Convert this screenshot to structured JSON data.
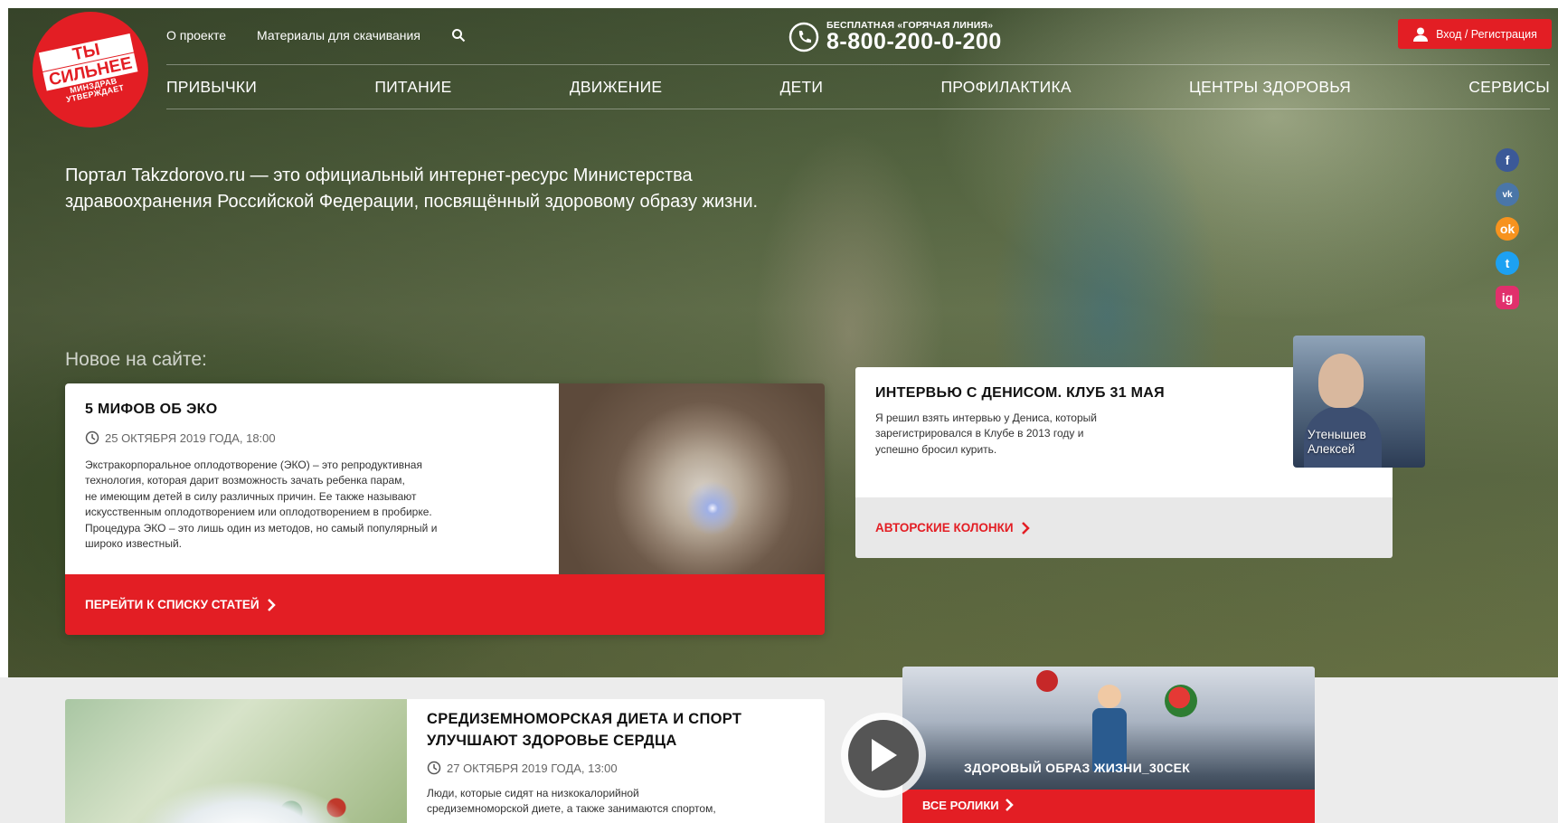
{
  "header": {
    "logo": {
      "hash": "#",
      "line1": "ТЫ",
      "line2": "СИЛЬНЕЕ",
      "line3": "МИНЗДРАВ",
      "line4": "УТВЕРЖДАЕТ"
    },
    "top_links": [
      "О проекте",
      "Материалы для скачивания"
    ],
    "hotline_caption": "БЕСПЛАТНАЯ «ГОРЯЧАЯ ЛИНИЯ»",
    "hotline_number": "8-800-200-0-200",
    "login_label": "Вход / Регистрация",
    "nav": [
      "ПРИВЫЧКИ",
      "ПИТАНИЕ",
      "ДВИЖЕНИЕ",
      "ДЕТИ",
      "ПРОФИЛАКТИКА",
      "ЦЕНТРЫ ЗДОРОВЬЯ",
      "СЕРВИСЫ"
    ]
  },
  "intro_text": "Портал Takzdorovo.ru — это официальный интернет-ресурс Министерства здравоохранения Российской Федерации, посвящённый здоровому образу жизни.",
  "social": {
    "facebook": "f",
    "vk": "vk",
    "ok": "ok",
    "twitter": "t",
    "instagram": "ig"
  },
  "new_label": "Новое на сайте:",
  "article_main": {
    "title": "5 МИФОВ ОБ ЭКО",
    "date": "25 ОКТЯБРЯ 2019 ГОДА, 18:00",
    "desc_lines": [
      "Экстракорпоральное оплодотворение (ЭКО) – это репродуктивная",
      "технология, которая дарит возможность зачать ребенка парам,",
      "не имеющим детей в силу различных причин. Ее также называют",
      "искусственным оплодотворением или оплодотворением в пробирке.",
      "Процедура ЭКО – это лишь один из методов, но самый популярный и",
      "широко известный."
    ],
    "link": "ПЕРЕЙТИ К СПИСКУ СТАТЕЙ"
  },
  "interview": {
    "title": "ИНТЕРВЬЮ С ДЕНИСОМ. КЛУБ 31 МАЯ",
    "desc_lines": [
      "Я решил взять интервью у Дениса, который",
      "зарегистрировался в Клубе в 2013 году и",
      "успешно бросил курить."
    ],
    "author": [
      "Утенышев",
      "Алексей"
    ],
    "link": "АВТОРСКИЕ КОЛОНКИ"
  },
  "article_second": {
    "title": "СРЕДИЗЕМНОМОРСКАЯ ДИЕТА И СПОРТ УЛУЧШАЮТ ЗДОРОВЬЕ СЕРДЦА",
    "date": "27 ОКТЯБРЯ 2019 ГОДА, 13:00",
    "desc_lines": [
      "Люди, которые сидят на низкокалорийной",
      "средиземноморской диете, а также занимаются спортом,"
    ]
  },
  "video": {
    "title": "ЗДОРОВЫЙ ОБРАЗ ЖИЗНИ_30СЕК",
    "link": "ВСЕ РОЛИКИ"
  },
  "colors": {
    "brand_red": "#e31e24",
    "panel_grey": "#e8e8e8",
    "page_grey": "#ececec"
  }
}
